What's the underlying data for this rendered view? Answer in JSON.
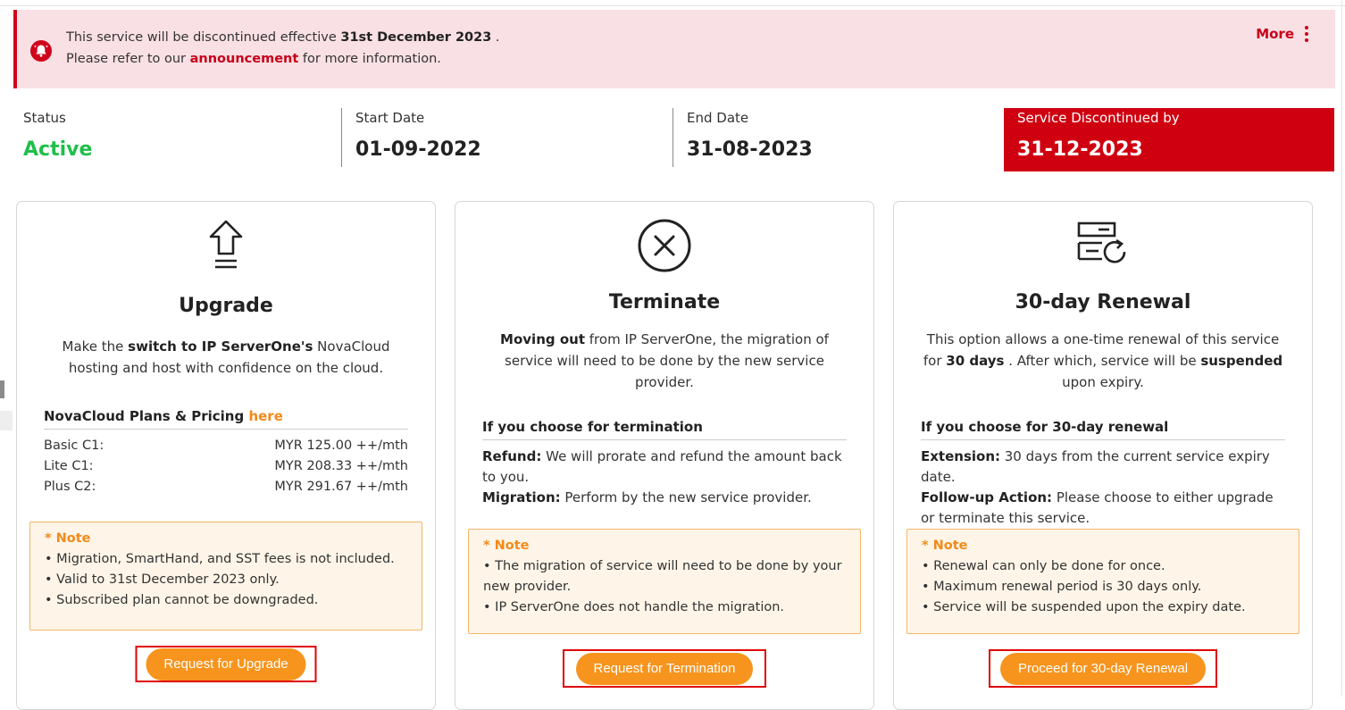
{
  "alert": {
    "line1_prefix": "This service will be discontinued effective ",
    "line1_bold": "31st December 2023",
    "line1_suffix": " .",
    "line2_prefix": "Please refer to our ",
    "line2_link": "announcement",
    "line2_suffix": " for more information.",
    "more_label": "More",
    "icon": "bell-icon"
  },
  "status": {
    "status_label": "Status",
    "status_value": "Active",
    "start_label": "Start Date",
    "start_value": "01-09-2022",
    "end_label": "End Date",
    "end_value": "31-08-2023",
    "discontinued_label": "Service Discontinued by",
    "discontinued_value": "31-12-2023"
  },
  "cards": {
    "upgrade": {
      "icon": "upload-arrow-icon",
      "title": "Upgrade",
      "desc_1": "Make the ",
      "desc_bold": "switch to IP ServerOne's",
      "desc_2": " NovaCloud hosting and host with confidence on the cloud.",
      "plans_head": "NovaCloud Plans & Pricing ",
      "plans_link": "here",
      "plans": [
        {
          "name": "Basic C1:",
          "price": "MYR 125.00 ++/mth"
        },
        {
          "name": "Lite C1:",
          "price": "MYR 208.33 ++/mth"
        },
        {
          "name": "Plus C2:",
          "price": "MYR 291.67 ++/mth"
        }
      ],
      "note_title": "* Note",
      "notes": [
        "• Migration, SmartHand, and SST fees is not included.",
        "• Valid to 31st December 2023 only.",
        "• Subscribed plan cannot be downgraded."
      ],
      "button": "Request for Upgrade"
    },
    "terminate": {
      "icon": "close-circle-icon",
      "title": "Terminate",
      "desc_bold": "Moving out",
      "desc_2": " from IP ServerOne, the migration of service will need to be done by the new service provider.",
      "section_head": "If you choose for termination",
      "refund_label": "Refund:",
      "refund_text": " We will prorate and refund the amount back to you.",
      "migration_label": "Migration:",
      "migration_text": " Perform by the new service provider.",
      "note_title": "* Note",
      "notes": [
        "• The migration of service will need to be done by your new provider.",
        "• IP ServerOne does not handle the migration."
      ],
      "button": "Request for Termination"
    },
    "renewal": {
      "icon": "server-renew-icon",
      "title": "30-day Renewal",
      "desc_1": "This option allows a one-time renewal of this service for ",
      "desc_bold1": "30 days",
      "desc_2": " . After which, service will be ",
      "desc_bold2": "suspended",
      "desc_3": " upon expiry.",
      "section_head": "If you choose for 30-day renewal",
      "ext_label": "Extension:",
      "ext_text": " 30 days from the current service expiry date.",
      "follow_label": "Follow-up Action:",
      "follow_text": " Please choose to either upgrade or terminate this service.",
      "note_title": "* Note",
      "notes": [
        "• Renewal can only be done for once.",
        "• Maximum renewal period is 30 days only.",
        "• Service will be suspended upon the expiry date."
      ],
      "button": "Proceed for 30-day Renewal"
    }
  },
  "colors": {
    "accent": "#f7941d",
    "danger": "#cf0010",
    "active": "#1fbf4a"
  }
}
